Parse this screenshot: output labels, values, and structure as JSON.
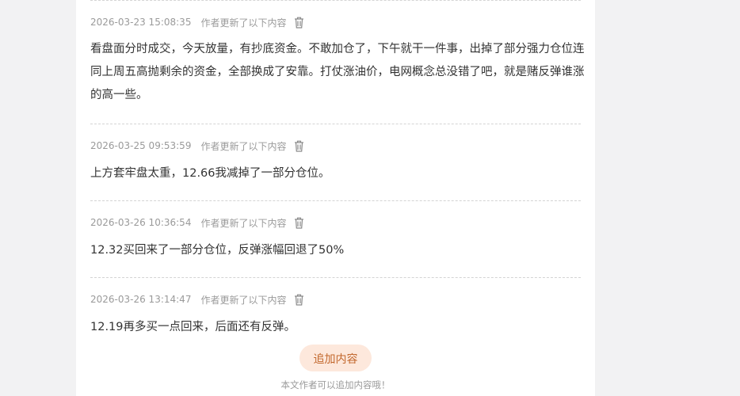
{
  "updates": [
    {
      "timestamp": "2026-03-23 15:08:35",
      "note": "作者更新了以下内容",
      "lines": [
        "看盘面分时成交，今天放量，有抄底资金。不敢加仓了，下午就干一件事，出掉了部分强力仓位连",
        "同上周五高抛剩余的资金，全部换成了安靠。打仗涨油价，电网概念总没错了吧，就是赌反弹谁涨",
        "的高一些。"
      ]
    },
    {
      "timestamp": "2026-03-25 09:53:59",
      "note": "作者更新了以下内容",
      "lines": [
        "上方套牢盘太重，12.66我减掉了一部分仓位。"
      ]
    },
    {
      "timestamp": "2026-03-26 10:36:54",
      "note": "作者更新了以下内容",
      "lines": [
        "12.32买回来了一部分仓位，反弹涨幅回退了50%"
      ]
    },
    {
      "timestamp": "2026-03-26 13:14:47",
      "note": "作者更新了以下内容",
      "lines": [
        "12.19再多买一点回来，后面还有反弹。"
      ]
    }
  ],
  "add_button_label": "追加内容",
  "footer_hint": "本文作者可以追加内容哦！",
  "icons": {
    "delete": "trash-icon"
  },
  "colors": {
    "accent_text": "#c2672c",
    "accent_bg": "#fde8dc",
    "meta_text": "#9a9a9a",
    "body_text": "#333333"
  }
}
